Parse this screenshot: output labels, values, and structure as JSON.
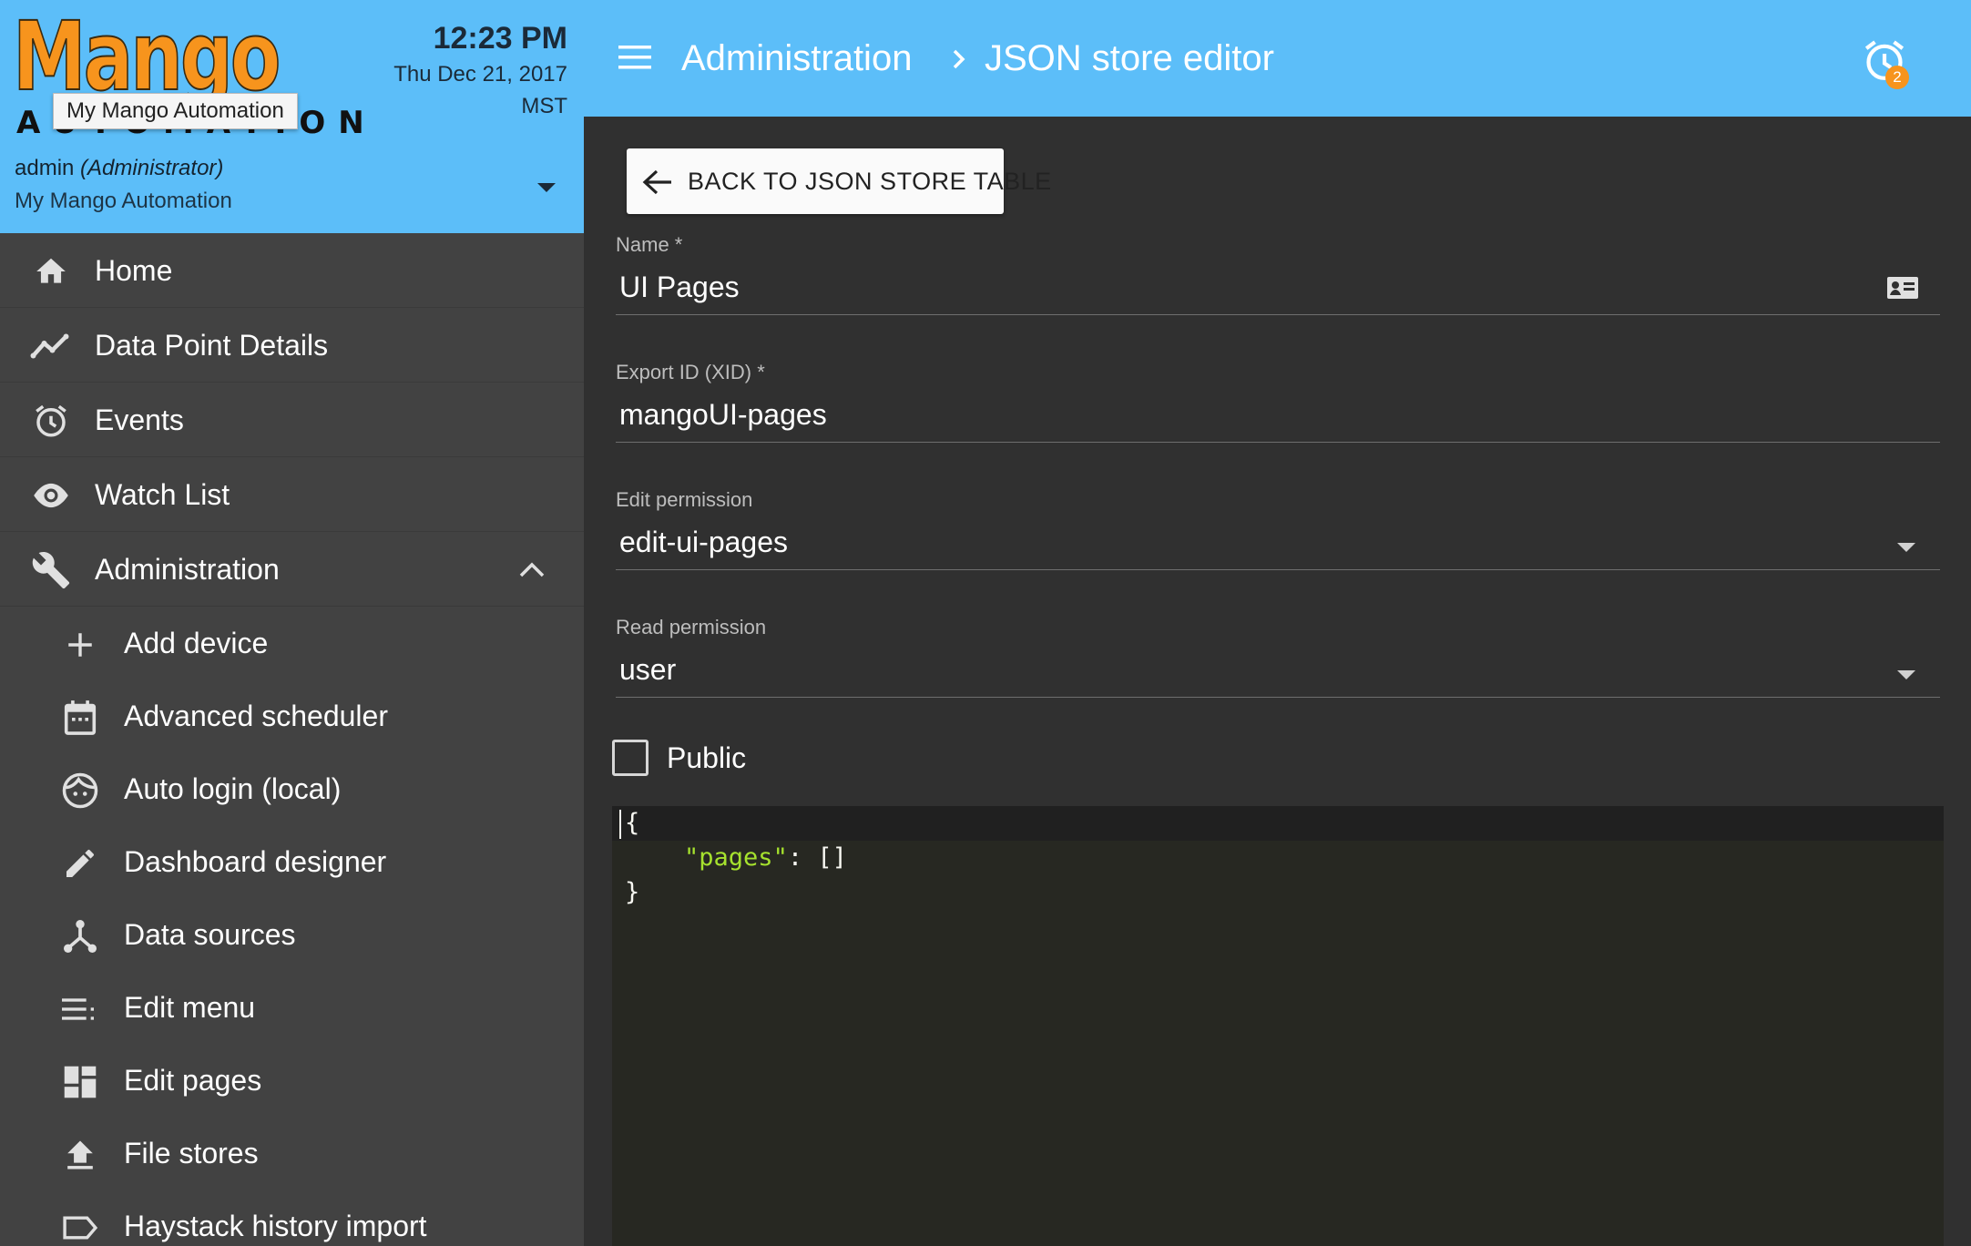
{
  "app": {
    "logo_text": "Mango",
    "logo_subtext": "AUTOMATION",
    "tooltip": "My Mango Automation",
    "clock_time": "12:23 PM",
    "clock_date": "Thu Dec 21, 2017",
    "clock_tz": "MST",
    "user_name": "admin",
    "user_role": "(Administrator)",
    "user_site": "My Mango Automation"
  },
  "nav": {
    "items": [
      {
        "label": "Home",
        "icon": "home-icon"
      },
      {
        "label": "Data Point Details",
        "icon": "trending-icon"
      },
      {
        "label": "Events",
        "icon": "alarm-icon"
      },
      {
        "label": "Watch List",
        "icon": "eye-icon"
      },
      {
        "label": "Administration",
        "icon": "wrench-icon"
      }
    ],
    "admin_items": [
      {
        "label": "Add device",
        "icon": "plus-icon"
      },
      {
        "label": "Advanced scheduler",
        "icon": "calendar-icon"
      },
      {
        "label": "Auto login (local)",
        "icon": "face-icon"
      },
      {
        "label": "Dashboard designer",
        "icon": "pencil-icon"
      },
      {
        "label": "Data sources",
        "icon": "hub-icon"
      },
      {
        "label": "Edit menu",
        "icon": "list-icon"
      },
      {
        "label": "Edit pages",
        "icon": "dashboard-icon"
      },
      {
        "label": "File stores",
        "icon": "upload-icon"
      },
      {
        "label": "Haystack history import",
        "icon": "tag-icon"
      }
    ]
  },
  "topbar": {
    "breadcrumb_parent": "Administration",
    "breadcrumb_current": "JSON store editor",
    "alarm_count": "2"
  },
  "main": {
    "back_button": "BACK TO JSON STORE TABLE",
    "fields": {
      "name": {
        "label": "Name *",
        "value": "UI Pages"
      },
      "xid": {
        "label": "Export ID (XID) *",
        "value": "mangoUI-pages"
      },
      "edit_permission": {
        "label": "Edit permission",
        "value": "edit-ui-pages"
      },
      "read_permission": {
        "label": "Read permission",
        "value": "user"
      }
    },
    "public_label": "Public",
    "public_checked": false,
    "code": {
      "line1": "{",
      "line2_key": "\"pages\"",
      "line2_rest": ": []",
      "line3": "}"
    }
  },
  "colors": {
    "accent": "#5cbef9",
    "logo_orange": "#f7941d",
    "sidebar_bg": "#424242",
    "main_bg": "#303030",
    "editor_bg": "#272822",
    "string_token": "#a6e22e"
  }
}
